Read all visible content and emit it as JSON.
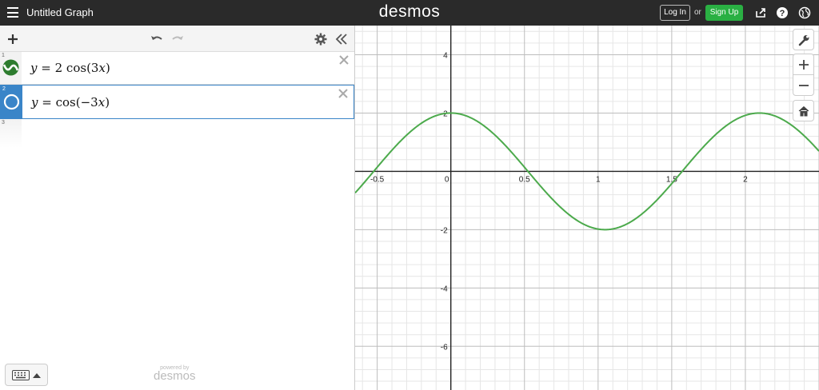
{
  "header": {
    "graph_title": "Untitled Graph",
    "logo": "desmos",
    "login_label": "Log In",
    "or_label": "or",
    "signup_label": "Sign Up"
  },
  "icons": {
    "menu": "menu-icon",
    "share": "share-icon",
    "help": "help-icon",
    "language": "globe-icon",
    "add": "plus-icon",
    "undo": "undo-icon",
    "redo": "redo-icon",
    "settings": "gear-icon",
    "collapse": "double-chevron-left-icon",
    "wrench": "wrench-icon",
    "zoom_in": "plus-icon",
    "zoom_out": "minus-icon",
    "home": "home-icon",
    "keyboard": "keyboard-icon"
  },
  "expressions": [
    {
      "number": "1",
      "lhs": "y",
      "rhs_coef": "2",
      "rhs_func": "cos",
      "rhs_arg": "3",
      "rhs_var": "x",
      "color": "#2d7c2e",
      "selected": false
    },
    {
      "number": "2",
      "lhs": "y",
      "rhs_func": "cos",
      "rhs_arg": "−3",
      "rhs_var": "x",
      "color": "#3a85c8",
      "selected": true
    },
    {
      "number": "3"
    }
  ],
  "footer": {
    "powered_by": "powered by",
    "brand": "desmos"
  },
  "chart_data": {
    "type": "line",
    "xlim": [
      -0.65,
      2.5
    ],
    "ylim": [
      -7.5,
      5.0
    ],
    "grid": true,
    "x_ticks": [
      "-0.5",
      "0",
      "0.5",
      "1",
      "1.5",
      "2"
    ],
    "y_ticks": [
      "4",
      "2",
      "-2",
      "-4",
      "-6"
    ],
    "series": [
      {
        "expression": "y = 2cos(3x)",
        "color": "#4caa4c",
        "amplitude": 2,
        "frequency": 3
      }
    ]
  }
}
